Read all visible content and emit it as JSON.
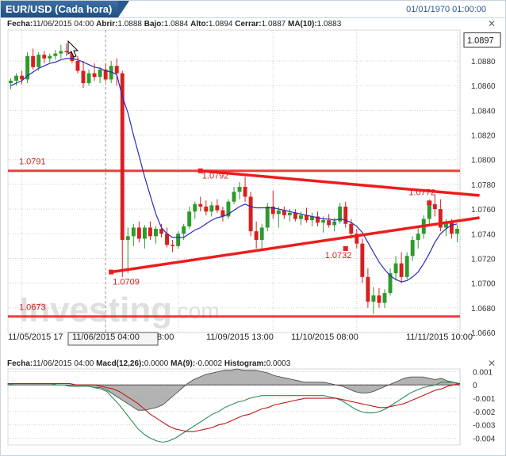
{
  "header": {
    "title": "EUR/USD (Cada hora)",
    "datetime": "01/01/1970 01:00:00"
  },
  "price_info": {
    "fecha_label": "Fecha:",
    "fecha": "11/06/2015 04:00",
    "abrir_label": "Abrir:",
    "abrir": "1.0888",
    "bajo_label": "Bajo:",
    "bajo": "1.0884",
    "alto_label": "Alto:",
    "alto": "1.0894",
    "cerrar_label": "Cerrar:",
    "cerrar": "1.0887",
    "ma_label": "MA(10):",
    "ma": "1.0883"
  },
  "macd_info": {
    "fecha_label": "Fecha:",
    "fecha": "11/06/2015 04:00",
    "macd_label": "Macd(12,26):",
    "macd": "0.0000",
    "ma_label": "MA(9):",
    "ma": "-0.0002",
    "hist_label": "Histogram:",
    "hist": "0.0003"
  },
  "watermark": {
    "brand": "Investing",
    "suffix": ".com"
  },
  "colors": {
    "up": "#2e9a2e",
    "down": "#d62020",
    "ma_line": "#2a2ab8",
    "trend": "#ee1c1c",
    "grid": "#cfcfcf",
    "accent": "#1f4f82"
  },
  "chart_data": [
    {
      "type": "candlestick",
      "title": "EUR/USD (Cada hora)",
      "ylim": [
        1.066,
        1.0905
      ],
      "yticks": [
        "1.0880",
        "1.0860",
        "1.0840",
        "1.0820",
        "1.0800",
        "1.0780",
        "1.0760",
        "1.0740",
        "1.0720",
        "1.0700",
        "1.0680",
        "1.0660"
      ],
      "xticks": [
        "11/05/2015 17",
        "11/06/2015 04:00",
        "8:00",
        "11/09/2015 13:00",
        "11/10/2015 08:00",
        "11/11/2015 10:00"
      ],
      "current_price": "1.0897",
      "grid": true,
      "candles": [
        [
          1.0862,
          1.0866,
          1.0857,
          1.0864
        ],
        [
          1.0864,
          1.087,
          1.086,
          1.0868
        ],
        [
          1.0868,
          1.0872,
          1.0861,
          1.0865
        ],
        [
          1.0865,
          1.0887,
          1.0862,
          1.0884
        ],
        [
          1.0884,
          1.089,
          1.0873,
          1.0875
        ],
        [
          1.0875,
          1.0887,
          1.0872,
          1.0885
        ],
        [
          1.0885,
          1.0888,
          1.0878,
          1.0882
        ],
        [
          1.0882,
          1.0886,
          1.0879,
          1.0884
        ],
        [
          1.0884,
          1.0889,
          1.0881,
          1.0886
        ],
        [
          1.0886,
          1.0893,
          1.0882,
          1.0888
        ],
        [
          1.0888,
          1.0894,
          1.0884,
          1.0887
        ],
        [
          1.0887,
          1.089,
          1.0878,
          1.088
        ],
        [
          1.088,
          1.0884,
          1.087,
          1.0872
        ],
        [
          1.0872,
          1.088,
          1.0858,
          1.0862
        ],
        [
          1.0862,
          1.0873,
          1.086,
          1.087
        ],
        [
          1.087,
          1.0878,
          1.0864,
          1.0867
        ],
        [
          1.0867,
          1.0875,
          1.0862,
          1.0873
        ],
        [
          1.0873,
          1.0878,
          1.0863,
          1.0865
        ],
        [
          1.0865,
          1.088,
          1.0862,
          1.0876
        ],
        [
          1.0876,
          1.0882,
          1.086,
          1.087
        ],
        [
          1.087,
          1.0872,
          1.0705,
          1.0735
        ],
        [
          1.0735,
          1.0745,
          1.0708,
          1.0738
        ],
        [
          1.0738,
          1.0748,
          1.073,
          1.0745
        ],
        [
          1.0745,
          1.075,
          1.0733,
          1.0736
        ],
        [
          1.0736,
          1.0747,
          1.0728,
          1.0745
        ],
        [
          1.0745,
          1.075,
          1.0735,
          1.0738
        ],
        [
          1.0738,
          1.0746,
          1.0732,
          1.0744
        ],
        [
          1.0744,
          1.0748,
          1.0737,
          1.074
        ],
        [
          1.074,
          1.0745,
          1.0729,
          1.0731
        ],
        [
          1.0731,
          1.0735,
          1.0725,
          1.073
        ],
        [
          1.073,
          1.0742,
          1.0728,
          1.074
        ],
        [
          1.074,
          1.0748,
          1.0735,
          1.0746
        ],
        [
          1.0746,
          1.0762,
          1.0744,
          1.0758
        ],
        [
          1.0758,
          1.0766,
          1.0752,
          1.0764
        ],
        [
          1.0764,
          1.077,
          1.0758,
          1.0762
        ],
        [
          1.0762,
          1.0767,
          1.0755,
          1.0758
        ],
        [
          1.0758,
          1.0766,
          1.0754,
          1.0763
        ],
        [
          1.0763,
          1.0768,
          1.0757,
          1.0759
        ],
        [
          1.0759,
          1.0762,
          1.075,
          1.0754
        ],
        [
          1.0754,
          1.0768,
          1.0752,
          1.0766
        ],
        [
          1.0766,
          1.0778,
          1.0764,
          1.0774
        ],
        [
          1.0774,
          1.0782,
          1.0768,
          1.0778
        ],
        [
          1.0778,
          1.0786,
          1.0766,
          1.077
        ],
        [
          1.077,
          1.0774,
          1.0738,
          1.0742
        ],
        [
          1.0742,
          1.075,
          1.0728,
          1.0735
        ],
        [
          1.0735,
          1.0748,
          1.0726,
          1.0745
        ],
        [
          1.0745,
          1.0765,
          1.0742,
          1.0762
        ],
        [
          1.0762,
          1.0775,
          1.0752,
          1.0756
        ],
        [
          1.0756,
          1.0762,
          1.0745,
          1.0759
        ],
        [
          1.0759,
          1.0762,
          1.0752,
          1.0755
        ],
        [
          1.0755,
          1.076,
          1.075,
          1.0757
        ],
        [
          1.0757,
          1.076,
          1.075,
          1.0752
        ],
        [
          1.0752,
          1.0758,
          1.0747,
          1.0755
        ],
        [
          1.0755,
          1.0761,
          1.0749,
          1.0751
        ],
        [
          1.0751,
          1.0757,
          1.0746,
          1.0754
        ],
        [
          1.0754,
          1.0758,
          1.0746,
          1.0749
        ],
        [
          1.0749,
          1.0754,
          1.0741,
          1.0751
        ],
        [
          1.0751,
          1.0756,
          1.0745,
          1.0747
        ],
        [
          1.0747,
          1.0753,
          1.0742,
          1.075
        ],
        [
          1.075,
          1.0765,
          1.0748,
          1.0762
        ],
        [
          1.0762,
          1.0766,
          1.0745,
          1.0748
        ],
        [
          1.0748,
          1.0752,
          1.0736,
          1.074
        ],
        [
          1.074,
          1.0744,
          1.0728,
          1.0732
        ],
        [
          1.0732,
          1.0736,
          1.07,
          1.0705
        ],
        [
          1.0705,
          1.0712,
          1.068,
          1.0685
        ],
        [
          1.0685,
          1.0697,
          1.0675,
          1.069
        ],
        [
          1.069,
          1.0696,
          1.068,
          1.0684
        ],
        [
          1.0684,
          1.0695,
          1.068,
          1.0692
        ],
        [
          1.0692,
          1.0712,
          1.069,
          1.0708
        ],
        [
          1.0708,
          1.0722,
          1.0702,
          1.0716
        ],
        [
          1.0716,
          1.0725,
          1.07,
          1.0705
        ],
        [
          1.0705,
          1.0725,
          1.0703,
          1.0722
        ],
        [
          1.0722,
          1.0738,
          1.0718,
          1.0735
        ],
        [
          1.0735,
          1.0746,
          1.0728,
          1.074
        ],
        [
          1.074,
          1.0755,
          1.0736,
          1.0752
        ],
        [
          1.0752,
          1.0768,
          1.0748,
          1.0764
        ],
        [
          1.0764,
          1.0772,
          1.0754,
          1.076
        ],
        [
          1.076,
          1.0768,
          1.0742,
          1.0745
        ],
        [
          1.0745,
          1.0752,
          1.0738,
          1.075
        ],
        [
          1.075,
          1.0752,
          1.0736,
          1.074
        ],
        [
          1.074,
          1.0747,
          1.0733,
          1.0744
        ]
      ],
      "ma10": [
        1.086,
        1.0862,
        1.0864,
        1.0868,
        1.0871,
        1.0874,
        1.0876,
        1.0878,
        1.0879,
        1.0881,
        1.0882,
        1.0882,
        1.0881,
        1.0879,
        1.0877,
        1.0875,
        1.0874,
        1.0872,
        1.0871,
        1.0869,
        1.0851,
        1.0838,
        1.082,
        1.0803,
        1.0786,
        1.0771,
        1.0756,
        1.0745,
        1.074,
        1.0737,
        1.0737,
        1.0737,
        1.074,
        1.0743,
        1.0745,
        1.0748,
        1.0751,
        1.0753,
        1.0754,
        1.0756,
        1.0759,
        1.0762,
        1.0764,
        1.0762,
        1.0761,
        1.0761,
        1.0761,
        1.0761,
        1.076,
        1.0759,
        1.0758,
        1.0757,
        1.0756,
        1.0755,
        1.0754,
        1.0753,
        1.0752,
        1.0752,
        1.0751,
        1.0752,
        1.0751,
        1.0749,
        1.0746,
        1.0741,
        1.0733,
        1.0725,
        1.0717,
        1.0711,
        1.0706,
        1.0703,
        1.0701,
        1.0702,
        1.0705,
        1.0709,
        1.0716,
        1.0724,
        1.0733,
        1.074,
        1.0744,
        1.0747,
        1.0748
      ],
      "horizontal_levels": [
        {
          "price": 1.0791,
          "label": "1.0791"
        },
        {
          "price": 1.0673,
          "label": "1.0673"
        }
      ],
      "trend_lines": [
        {
          "from_index": 34,
          "from_price": 1.0791,
          "to_index": 84,
          "to_price": 1.0771,
          "label": "1.0792",
          "label_index": 34
        },
        {
          "from_index": 18,
          "from_price": 1.0709,
          "to_index": 84,
          "to_price": 1.0753,
          "label": "1.0709",
          "label_index": 18
        }
      ],
      "point_labels": [
        {
          "index": 75,
          "price": 1.0765,
          "label": "1.0772"
        },
        {
          "index": 60,
          "price": 1.0728,
          "label": "1.0732"
        }
      ]
    },
    {
      "type": "line",
      "title": "Macd(12,26)",
      "ylim": [
        -0.0045,
        0.0012
      ],
      "yticks": [
        "0.001",
        "0",
        "-0.001",
        "-0.002",
        "-0.003",
        "-0.004"
      ],
      "zero_line": true,
      "series": [
        {
          "name": "Macd(12,26)",
          "color": "#2e8b57",
          "values": [
            0.0,
            0.0001,
            0.0001,
            0.0001,
            0.0001,
            0.0001,
            0.0001,
            0.0001,
            0.0,
            0.0,
            -0.0001,
            -0.0001,
            -0.0001,
            -0.0001,
            -0.0002,
            -0.0003,
            -0.0005,
            -0.001,
            -0.0015,
            -0.0021,
            -0.0027,
            -0.0033,
            -0.0037,
            -0.004,
            -0.0042,
            -0.0043,
            -0.0042,
            -0.004,
            -0.0037,
            -0.0034,
            -0.0031,
            -0.0028,
            -0.0025,
            -0.0022,
            -0.002,
            -0.0017,
            -0.0015,
            -0.0013,
            -0.0012,
            -0.001,
            -0.0009,
            -0.0008,
            -0.0008,
            -0.0008,
            -0.0008,
            -0.0008,
            -0.0008,
            -0.0008,
            -0.0008,
            -0.0008,
            -0.0008,
            -0.0008,
            -0.0009,
            -0.001,
            -0.0012,
            -0.0015,
            -0.0018,
            -0.002,
            -0.0021,
            -0.0021,
            -0.002,
            -0.0018,
            -0.0015,
            -0.0012,
            -0.0009,
            -0.0006,
            -0.0004,
            -0.0002,
            -0.0001,
            0.0,
            0.0002,
            0.0002,
            0.0002,
            0.0001
          ]
        },
        {
          "name": "MA(9)",
          "color": "#c01818",
          "values": [
            0.0001,
            0.0001,
            0.0001,
            0.0001,
            0.0001,
            0.0001,
            0.0001,
            0.0001,
            0.0001,
            0.0001,
            0.0001,
            0.0,
            0.0,
            0.0,
            0.0,
            -0.0001,
            -0.0002,
            -0.0003,
            -0.0005,
            -0.0008,
            -0.0011,
            -0.0014,
            -0.0018,
            -0.0022,
            -0.0025,
            -0.0028,
            -0.0031,
            -0.0033,
            -0.0034,
            -0.0035,
            -0.0035,
            -0.0034,
            -0.0033,
            -0.0032,
            -0.003,
            -0.0029,
            -0.0027,
            -0.0025,
            -0.0023,
            -0.0022,
            -0.002,
            -0.0018,
            -0.0017,
            -0.0015,
            -0.0014,
            -0.0013,
            -0.0012,
            -0.0011,
            -0.001,
            -0.001,
            -0.001,
            -0.001,
            -0.001,
            -0.001,
            -0.0011,
            -0.0012,
            -0.0013,
            -0.0014,
            -0.0015,
            -0.0016,
            -0.0017,
            -0.0017,
            -0.0016,
            -0.0015,
            -0.0014,
            -0.0012,
            -0.001,
            -0.0008,
            -0.0006,
            -0.0004,
            -0.0003,
            -0.0001,
            0.0,
            0.0001
          ]
        }
      ],
      "histogram": {
        "name": "Histogram",
        "color": "#8a8a8a",
        "values": [
          0.0001,
          0.0001,
          0.0001,
          0.0001,
          0.0001,
          0.0001,
          0.0001,
          0.0001,
          0.0,
          0.0,
          -0.0001,
          -0.0001,
          -0.0001,
          -0.0001,
          -0.0002,
          -0.0002,
          -0.0004,
          -0.0007,
          -0.001,
          -0.0013,
          -0.0016,
          -0.0019,
          -0.0019,
          -0.0018,
          -0.0017,
          -0.0015,
          -0.0011,
          -0.0007,
          -0.0003,
          0.0001,
          0.0004,
          0.0006,
          0.0008,
          0.0009,
          0.001,
          0.0011,
          0.0011,
          0.0012,
          0.0011,
          0.0011,
          0.0011,
          0.001,
          0.0009,
          0.0007,
          0.0006,
          0.0005,
          0.0004,
          0.0003,
          0.0002,
          0.0002,
          0.0002,
          0.0002,
          0.0001,
          0.0,
          -0.0001,
          -0.0003,
          -0.0005,
          -0.0006,
          -0.0006,
          -0.0005,
          -0.0003,
          -0.0001,
          0.0001,
          0.0003,
          0.0005,
          0.0006,
          0.0006,
          0.0006,
          0.0005,
          0.0004,
          0.0005,
          0.0003,
          0.0002,
          0.0
        ]
      }
    }
  ]
}
